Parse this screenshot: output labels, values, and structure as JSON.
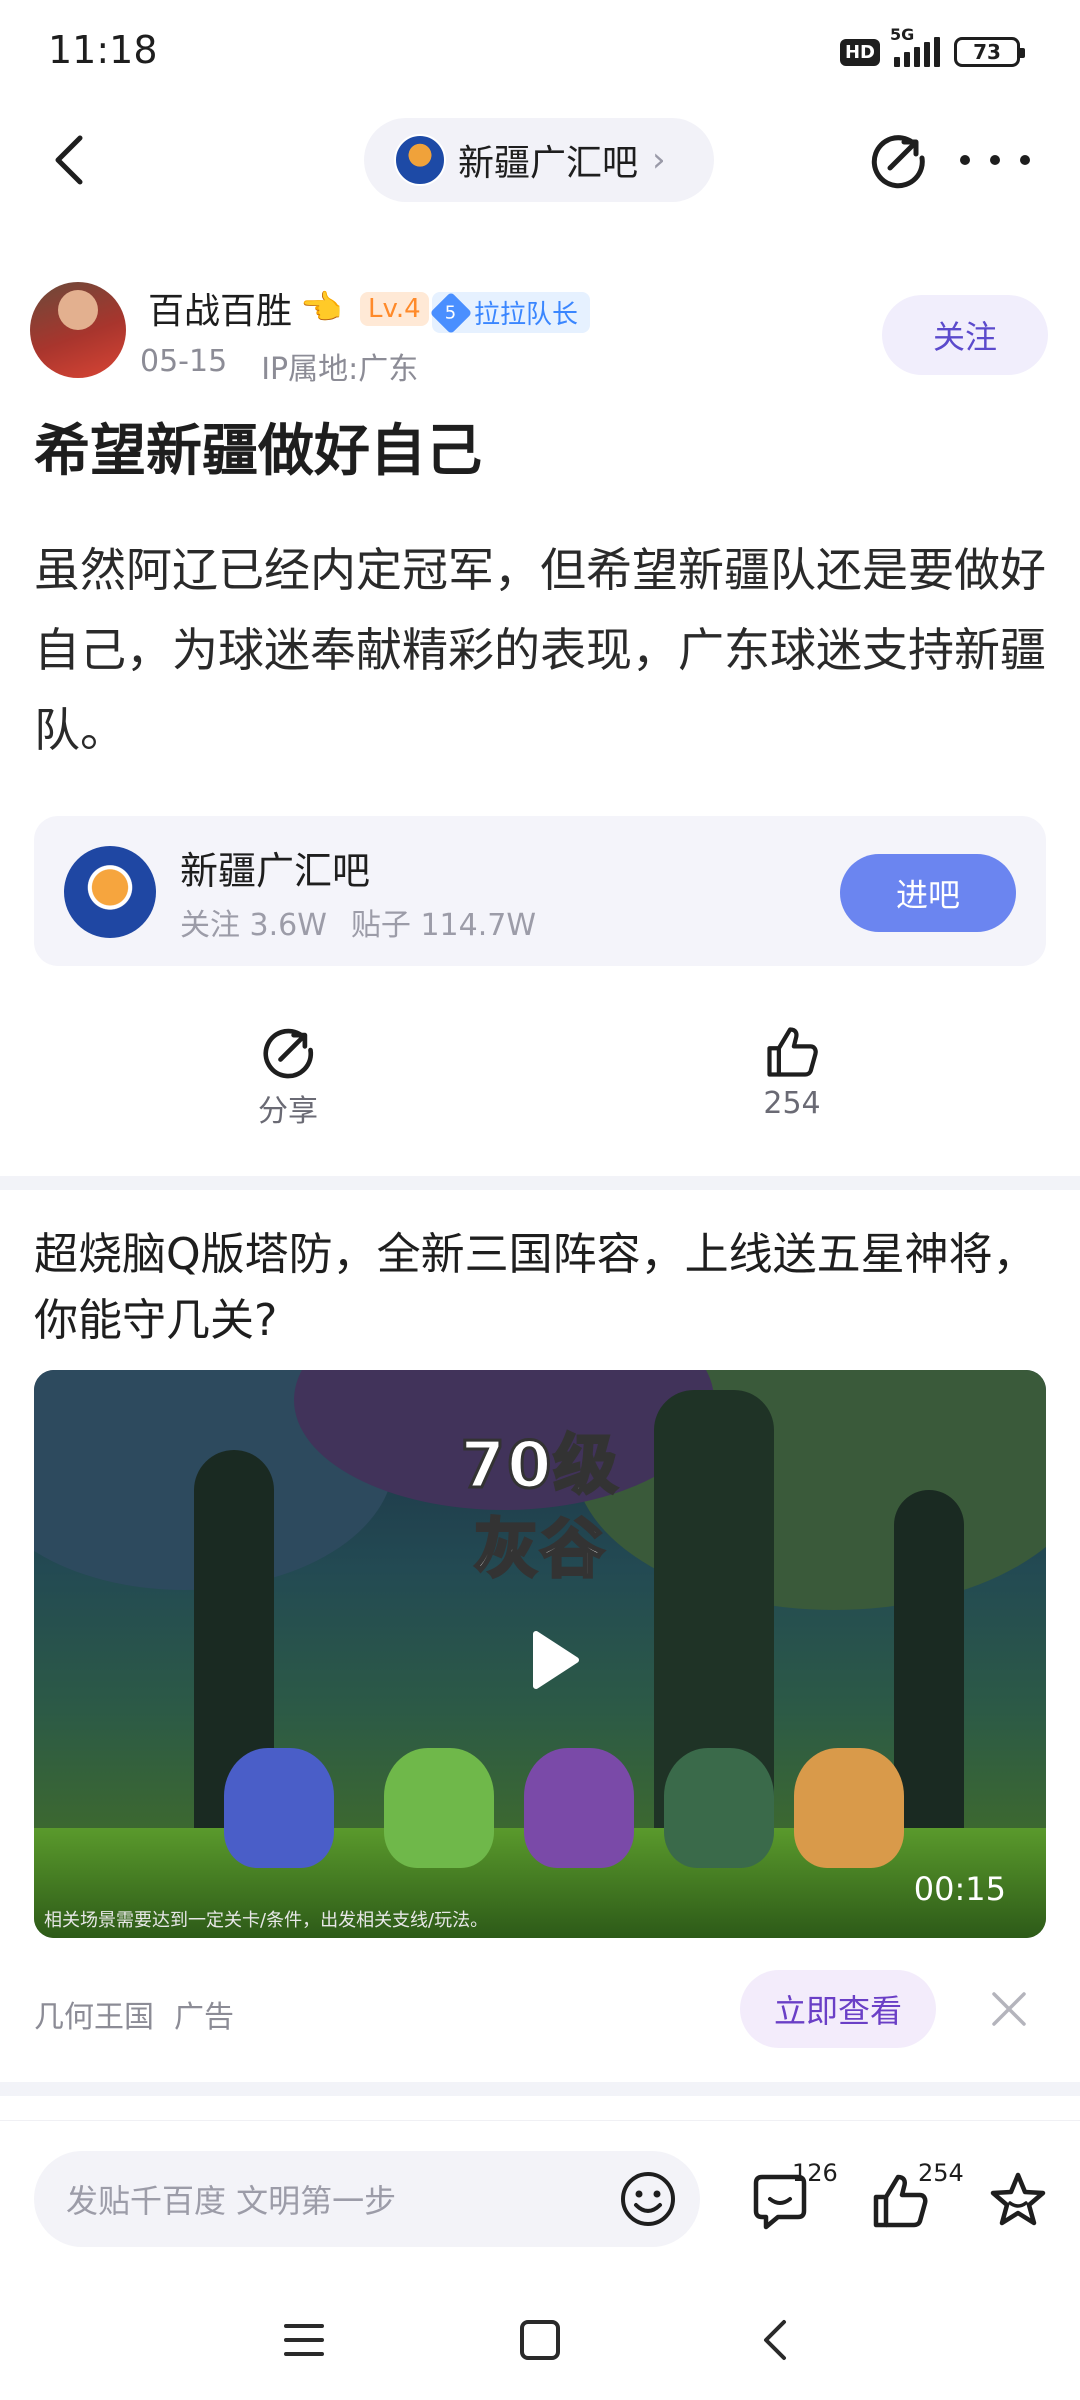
{
  "status_bar": {
    "time": "11:18",
    "hd": "HD",
    "network": "5G",
    "battery": "73"
  },
  "nav": {
    "forum_name": "新疆广汇吧",
    "chevron": "›"
  },
  "post": {
    "author": {
      "name": "百战百胜",
      "emoji": "👈",
      "level": "Lv.4",
      "fan_level": "5",
      "fan_title": "拉拉队长",
      "date": "05-15",
      "ip": "IP属地:广东",
      "follow_label": "关注"
    },
    "title": "希望新疆做好自己",
    "body": "虽然阿辽已经内定冠军，但希望新疆队还是要做好自己，为球迷奉献精彩的表现，广东球迷支持新疆队。"
  },
  "forum_card": {
    "name": "新疆广汇吧",
    "followers": "关注 3.6W",
    "posts": "贴子 114.7W",
    "enter_label": "进吧"
  },
  "actions": {
    "share_label": "分享",
    "like_count": "254"
  },
  "ad": {
    "title": "超烧脑Q版塔防，全新三国阵容，上线送五星神将，你能守几关?",
    "overlay_line1": "70级",
    "overlay_line2": "灰谷",
    "duration": "00:15",
    "disclaimer": "相关场景需要达到一定关卡/条件，出发相关支线/玩法。",
    "advertiser": "几何王国",
    "ad_label": "广告",
    "cta_label": "立即查看"
  },
  "bottom_bar": {
    "comment_placeholder": "发贴千百度 文明第一步",
    "comment_count": "126",
    "like_count": "254"
  },
  "colors": {
    "accent": "#6b85f0",
    "follow_text": "#5b4acc",
    "cta_text": "#6a3fc6",
    "level_badge": "#ff8a2a",
    "fan_badge": "#3a86ff"
  },
  "icons": [
    "back-icon",
    "share-icon",
    "more-icon",
    "forum-logo",
    "like-icon",
    "play-icon",
    "close-icon",
    "emoji-icon",
    "comment-icon",
    "star-icon",
    "menu-icon",
    "home-icon",
    "nav-back-icon"
  ]
}
